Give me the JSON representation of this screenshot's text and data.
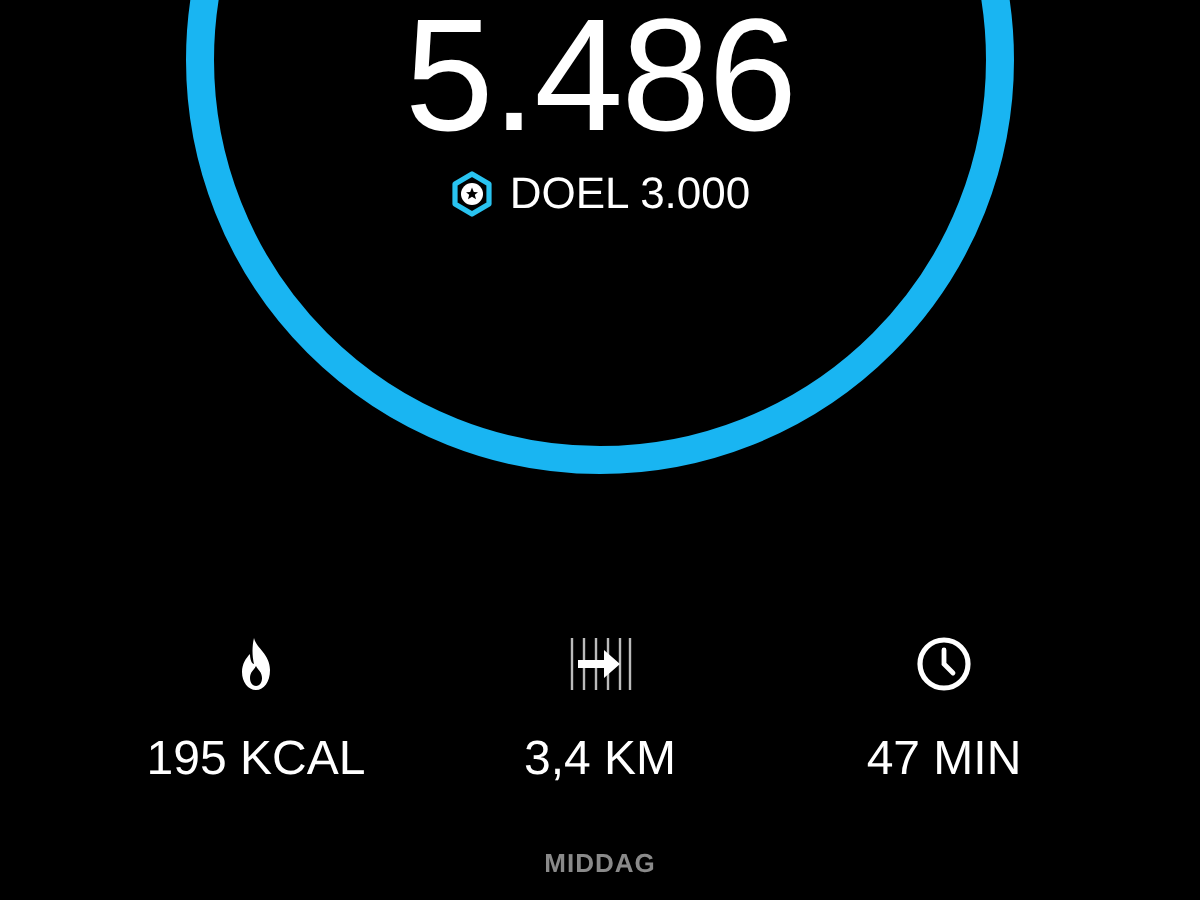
{
  "steps": {
    "value": "5.486",
    "goal": "DOEL 3.000"
  },
  "stats": [
    {
      "kind": "calories",
      "value": "195 KCAL"
    },
    {
      "kind": "distance",
      "value": "3,4 KM"
    },
    {
      "kind": "duration",
      "value": "47 MIN"
    }
  ],
  "period": "MIDDAG"
}
